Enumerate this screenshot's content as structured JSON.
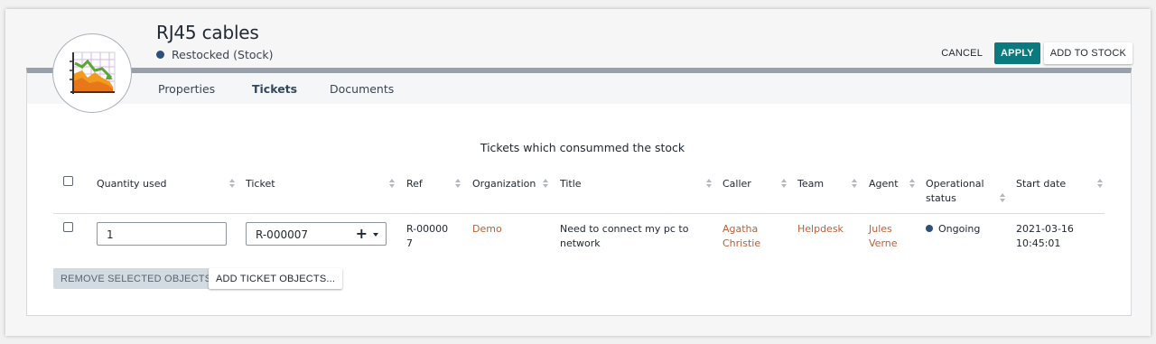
{
  "header": {
    "title": "RJ45 cables",
    "status": "Restocked (Stock)",
    "status_color": "#2d4f7c",
    "logo_icon": "stock-chart-icon"
  },
  "actions": {
    "cancel": "CANCEL",
    "apply": "APPLY",
    "add_to_stock": "ADD TO STOCK"
  },
  "tabs": [
    {
      "label": "Properties",
      "active": false
    },
    {
      "label": "Tickets",
      "active": true
    },
    {
      "label": "Documents",
      "active": false
    }
  ],
  "section": {
    "title": "Tickets which consummed the stock"
  },
  "table": {
    "columns": [
      "Quantity used",
      "Ticket",
      "Ref",
      "Organization",
      "Title",
      "Caller",
      "Team",
      "Agent",
      "Operational status",
      "Start date"
    ],
    "rows": [
      {
        "quantity": "1",
        "ticket": "R-000007",
        "ref": "R-000007",
        "organization": "Demo",
        "title": "Need to connect my pc to network",
        "caller": "Agatha Christie",
        "team": "Helpdesk",
        "agent": "Jules Verne",
        "status": "Ongoing",
        "start_date": "2021-03-16 10:45:01"
      }
    ]
  },
  "footer": {
    "remove": "REMOVE SELECTED OBJECTS",
    "add": "ADD TICKET OBJECTS..."
  },
  "colors": {
    "accent": "#0b7a7e",
    "link": "#b85f37",
    "header_bar": "#97a0ab"
  }
}
